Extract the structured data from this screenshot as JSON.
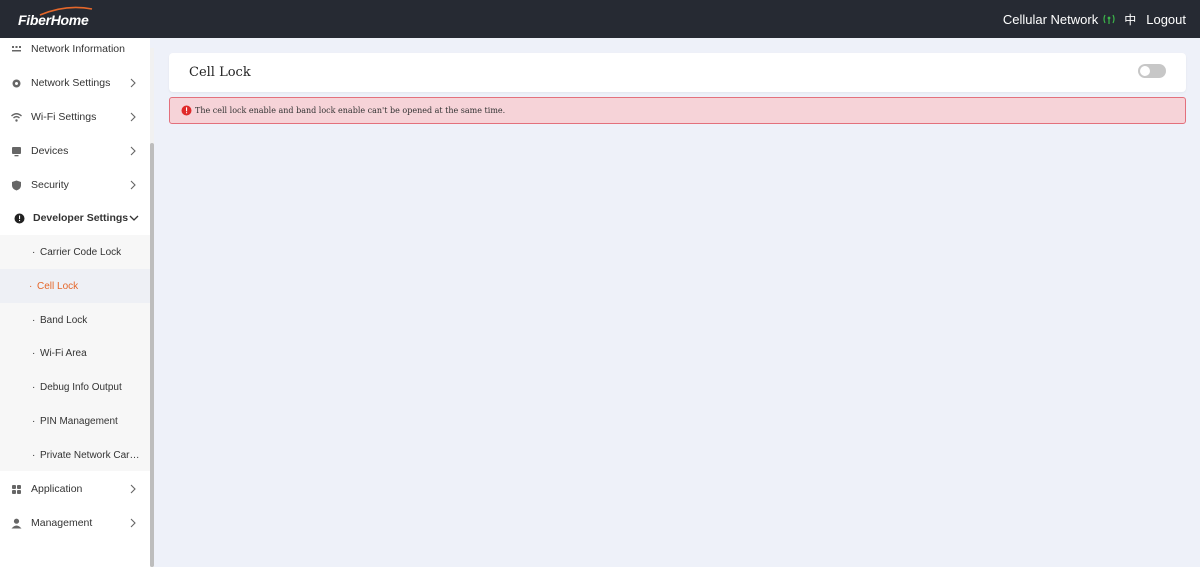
{
  "header": {
    "logo_text": "FiberHome",
    "network_label": "Cellular Network",
    "language": "中",
    "logout_label": "Logout",
    "accent_color": "#e5672a",
    "signal_color": "#3cb54a"
  },
  "sidebar": {
    "items": [
      {
        "label": "Network Information",
        "icon": "network-info-icon"
      },
      {
        "label": "Network Settings",
        "icon": "gear-icon"
      },
      {
        "label": "Wi-Fi Settings",
        "icon": "wifi-icon"
      },
      {
        "label": "Devices",
        "icon": "monitor-icon"
      },
      {
        "label": "Security",
        "icon": "shield-icon"
      },
      {
        "label": "Developer Settings",
        "icon": "exclamation-circle-icon",
        "expanded": true
      },
      {
        "label": "Application",
        "icon": "apps-grid-icon"
      },
      {
        "label": "Management",
        "icon": "user-icon"
      }
    ],
    "developer_submenu": [
      {
        "label": "Carrier Code Lock"
      },
      {
        "label": "Cell Lock",
        "active": true
      },
      {
        "label": "Band Lock"
      },
      {
        "label": "Wi-Fi Area"
      },
      {
        "label": "Debug Info Output"
      },
      {
        "label": "PIN Management"
      },
      {
        "label": "Private Network Carrier"
      }
    ]
  },
  "main": {
    "card_title": "Cell Lock",
    "toggle_enabled": false,
    "alert": {
      "text": "The cell lock enable and band lock enable can't be opened at the same time.",
      "color": "#e02a2a"
    }
  }
}
